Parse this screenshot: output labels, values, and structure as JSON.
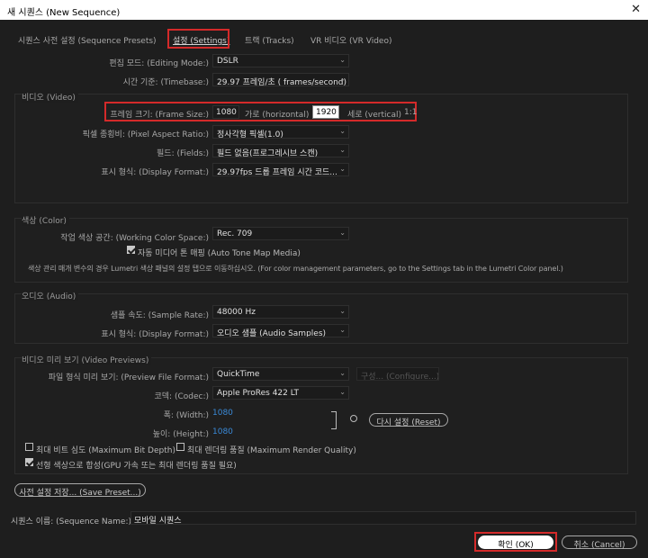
{
  "window": {
    "title": "새 시퀀스 (New Sequence)",
    "close": "✕"
  },
  "tabs": [
    {
      "label": "시퀀스 사전 설정 (Sequence Presets)",
      "active": false
    },
    {
      "label": "설정 (Settings)",
      "active": true
    },
    {
      "label": "트랙 (Tracks)",
      "active": false
    },
    {
      "label": "VR 비디오 (VR Video)",
      "active": false
    }
  ],
  "general": {
    "editing_mode_label": "편집 모드: (Editing Mode:)",
    "editing_mode_value": "DSLR",
    "timebase_label": "시간 기준: (Timebase:)",
    "timebase_value": "29.97 프레임/초 ( frames/second)"
  },
  "video": {
    "section_title": "비디오 (Video)",
    "frame_size_label": "프레임 크기: (Frame Size:)",
    "horizontal_value": "1080",
    "horizontal_label": "가로 (horizontal)",
    "vertical_value": "1920",
    "vertical_label": "세로 (vertical)",
    "aspect": "1:1",
    "pixel_aspect_label": "픽셀 종횡비: (Pixel Aspect Ratio:)",
    "pixel_aspect_value": "정사각형 픽셀(1.0)",
    "fields_label": "필드: (Fields:)",
    "fields_value": "필드 없음(프로그레시브 스캔)",
    "display_format_label": "표시 형식: (Display Format:)",
    "display_format_value": "29.97fps 드롭 프레임 시간 코드..."
  },
  "color": {
    "section_title": "색상 (Color)",
    "working_space_label": "작업 색상 공간: (Working Color Space:)",
    "working_space_value": "Rec. 709",
    "tone_map_label": "자동 미디어 톤 매핑 (Auto Tone Map Media)",
    "tone_map_checked": true,
    "note": "색상 관리 매개 변수의 경우 Lumetri 색상 패널의 설정 탭으로 이동하십시오. (For color management parameters, go to the Settings tab in the Lumetri Color panel.)"
  },
  "audio": {
    "section_title": "오디오 (Audio)",
    "sample_rate_label": "샘플 속도: (Sample Rate:)",
    "sample_rate_value": "48000 Hz",
    "display_format_label": "표시 형식: (Display Format:)",
    "display_format_value": "오디오 샘플 (Audio Samples)"
  },
  "previews": {
    "section_title": "비디오 미리 보기 (Video Previews)",
    "file_format_label": "파일 형식 미리 보기: (Preview File Format:)",
    "file_format_value": "QuickTime",
    "configure_label": "구성... (Configure...)",
    "codec_label": "코덱: (Codec:)",
    "codec_value": "Apple ProRes 422 LT",
    "width_label": "폭: (Width:)",
    "width_value": "1080",
    "height_label": "높이: (Height:)",
    "height_value": "1080",
    "reset_label": "다시 설정 (Reset)",
    "max_bit_depth_label": "최대 비트 심도 (Maximum Bit Depth)",
    "max_bit_depth_checked": false,
    "max_render_label": "최대 렌더링 품질 (Maximum Render Quality)",
    "max_render_checked": false,
    "linear_color_label": "선형 색상으로 합성(GPU 가속 또는 최대 렌더링 품질 필요)",
    "linear_color_checked": true
  },
  "save_preset_label": "사전 설정 저장... (Save Preset...)",
  "sequence_name_label": "시퀀스 이름: (Sequence Name:)",
  "sequence_name_value": "모바일 시퀀스",
  "ok_label": "확인 (OK)",
  "cancel_label": "취소 (Cancel)",
  "colors": {
    "highlight_red": "#d42a2a",
    "link_blue": "#3a8ad8",
    "background": "#1e1e1e"
  }
}
